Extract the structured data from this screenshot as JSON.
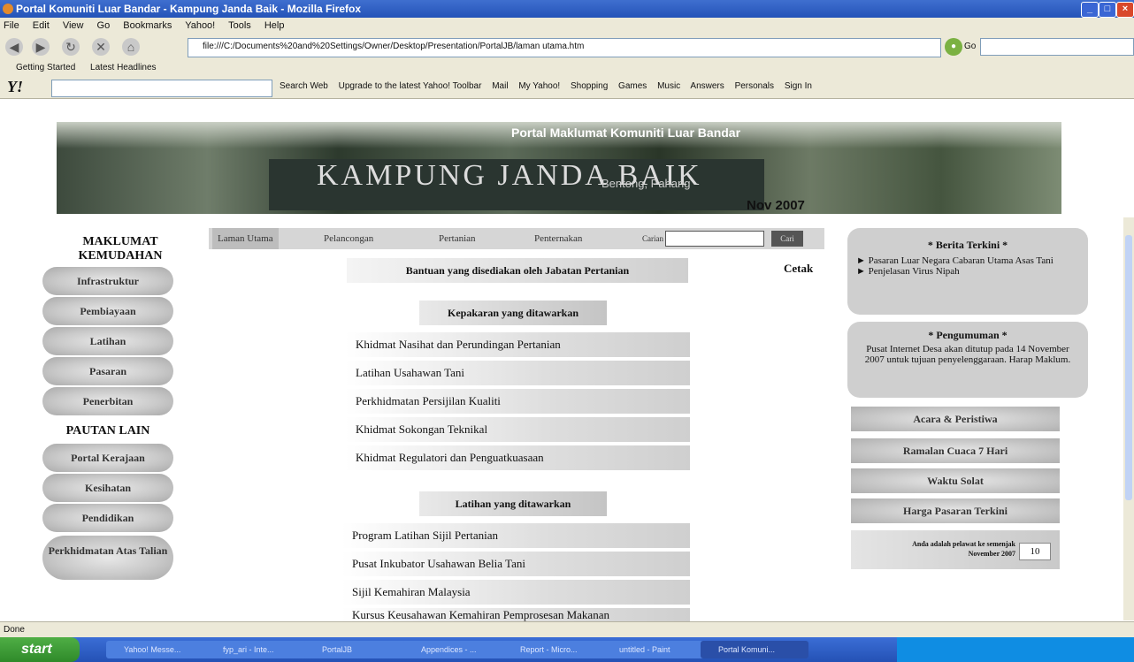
{
  "window": {
    "title": "Portal Komuniti Luar Bandar - Kampung Janda Baik - Mozilla Firefox",
    "controls": [
      "_",
      "□",
      "×"
    ]
  },
  "menu": [
    "File",
    "Edit",
    "View",
    "Go",
    "Bookmarks",
    "Yahoo!",
    "Tools",
    "Help"
  ],
  "nav": {
    "url": "file:///C:/Documents%20and%20Settings/Owner/Desktop/Presentation/PortalJB/laman utama.htm",
    "go_label": "Go"
  },
  "bookmarks": [
    "Getting Started",
    "Latest Headlines"
  ],
  "yahoo_toolbar": {
    "logo": "Y!",
    "items": [
      "Search Web",
      "Upgrade to the latest Yahoo! Toolbar",
      "Mail",
      "My Yahoo!",
      "Shopping",
      "Games",
      "Music",
      "Answers",
      "Personals",
      "Sign In"
    ]
  },
  "banner": {
    "portal": "Portal Maklumat Komuniti Luar Bandar",
    "kampung": "KAMPUNG JANDA BAIK",
    "location": "Bentong, Pahang",
    "date": "Nov 2007"
  },
  "left": {
    "heading1": "MAKLUMAT KEMUDAHAN",
    "kemudahan": [
      "Infrastruktur",
      "Pembiayaan",
      "Latihan",
      "Pasaran",
      "Penerbitan"
    ],
    "heading2": "PAUTAN LAIN",
    "pautan": [
      "Portal Kerajaan",
      "Kesihatan",
      "Pendidikan",
      "Perkhidmatan Atas Talian"
    ]
  },
  "topnav": {
    "items": [
      "Laman Utama",
      "Pelancongan",
      "Pertanian",
      "Penternakan"
    ],
    "search_label": "Carian",
    "search_button": "Cari"
  },
  "main": {
    "header": "Bantuan yang disediakan oleh Jabatan Pertanian",
    "print": "Cetak",
    "section1": "Kepakaran yang ditawarkan",
    "section1_items": [
      "Khidmat Nasihat dan Perundingan Pertanian",
      "Latihan Usahawan Tani",
      "Perkhidmatan Persijilan Kualiti",
      "Khidmat Sokongan Teknikal",
      "Khidmat Regulatori dan Penguatkuasaan"
    ],
    "section2": "Latihan yang ditawarkan",
    "section2_items": [
      "Program Latihan Sijil Pertanian",
      "Pusat Inkubator Usahawan Belia Tani",
      "Sijil Kemahiran Malaysia",
      "Kursus Keusahawan Kemahiran Pemprosesan Makanan"
    ]
  },
  "right": {
    "berita_title": "* Berita Terkini *",
    "berita": [
      "Pasaran Luar Negara Cabaran Utama Asas Tani",
      "Penjelasan Virus Nipah"
    ],
    "pengumuman_title": "* Pengumuman *",
    "pengumuman_text": "Pusat Internet Desa akan ditutup pada 14 November 2007 untuk tujuan penyelenggaraan. Harap Maklum.",
    "buttons": [
      "Acara & Peristiwa",
      "Ramalan Cuaca 7 Hari",
      "Waktu Solat",
      "Harga Pasaran Terkini"
    ],
    "visitor_text": "Anda adalah pelawat ke semenjak November 2007",
    "visitor_count": "10"
  },
  "status": "Done",
  "taskbar": {
    "start": "start",
    "tasks": [
      "Yahoo! Messe...",
      "fyp_ari - Inte...",
      "PortalJB",
      "Appendices - ...",
      "Report - Micro...",
      "untitled - Paint",
      "Portal Komuni..."
    ]
  }
}
